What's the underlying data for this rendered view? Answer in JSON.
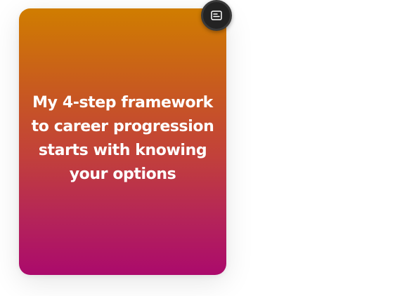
{
  "card": {
    "lines": [
      "My 4-step framework",
      "to career progression",
      "starts with knowing",
      "your options"
    ]
  },
  "captions_button": {
    "icon": "captions-icon"
  }
}
